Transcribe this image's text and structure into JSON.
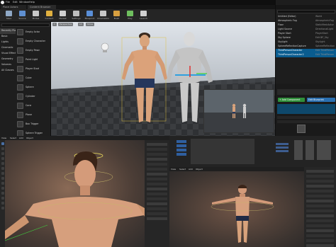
{
  "ue": {
    "menus": [
      "File",
      "Edit",
      "Window",
      "Help"
    ],
    "tabs": [
      "Place Actors",
      "Content Browser"
    ],
    "toolbar": [
      {
        "label": "Save",
        "icon": "save-icon",
        "color": "#8fa8c6"
      },
      {
        "label": "Source",
        "icon": "source-control-icon",
        "color": "#5f8fd0"
      },
      {
        "label": "Modes",
        "icon": "modes-icon",
        "color": "#c9c9c9"
      },
      {
        "label": "Content",
        "icon": "content-icon",
        "color": "#e0b040"
      },
      {
        "label": "Market",
        "icon": "marketplace-icon",
        "color": "#d0d0d0"
      },
      {
        "label": "Settings",
        "icon": "settings-icon",
        "color": "#bfbfbf"
      },
      {
        "label": "Blueprint",
        "icon": "blueprint-icon",
        "color": "#5a8fd8"
      },
      {
        "label": "Cinematics",
        "icon": "cinematics-icon",
        "color": "#c8c8c8"
      },
      {
        "label": "Build",
        "icon": "build-icon",
        "color": "#d8a040"
      },
      {
        "label": "Play",
        "icon": "play-icon",
        "color": "#6fbf5f"
      },
      {
        "label": "Launch",
        "icon": "launch-icon",
        "color": "#d0d0d0"
      }
    ],
    "categories": [
      "Recently Placed",
      "Basic",
      "Lights",
      "Cinematic",
      "Visual Effects",
      "Geometry",
      "Volumes",
      "All Classes"
    ],
    "placeables": [
      "Empty Actor",
      "Empty Character",
      "Empty Pawn",
      "Point Light",
      "Player Start",
      "Cube",
      "Sphere",
      "Cylinder",
      "Cone",
      "Plane",
      "Box Trigger",
      "Sphere Trigger"
    ],
    "viewport_buttons": [
      "Perspective",
      "Lit",
      "Show"
    ],
    "outliner": [
      {
        "name": "Untitled (Editor)",
        "type": "World"
      },
      {
        "name": "Atmospheric Fog",
        "type": "AtmosphericFog"
      },
      {
        "name": "Floor",
        "type": "StaticMeshActor"
      },
      {
        "name": "Light Source",
        "type": "DirectionalLight"
      },
      {
        "name": "Player Start",
        "type": "PlayerStart"
      },
      {
        "name": "Sky Sphere",
        "type": "Edit BP_Sky"
      },
      {
        "name": "SkyLight",
        "type": "SkyLight"
      },
      {
        "name": "SphereReflectionCapture",
        "type": "SphereReflection"
      },
      {
        "name": "ThirdPersonCharacter",
        "type": "Edit ThirdPerson"
      },
      {
        "name": "ThirdPersonCharacter2",
        "type": "Edit ThirdPerson"
      }
    ],
    "details": {
      "add_component": "+ Add Component",
      "edit_blueprint": "Edit Blueprint"
    }
  },
  "blender": {
    "bl1_menus": [
      "View",
      "Select",
      "Add",
      "Object"
    ],
    "bl2_menus": [
      "View",
      "Select",
      "Add",
      "Object"
    ]
  },
  "colors": {
    "accent_blue": "#0a5c8f",
    "add_green": "#2f8f3a",
    "blueprint_blue": "#2a6fb0"
  }
}
